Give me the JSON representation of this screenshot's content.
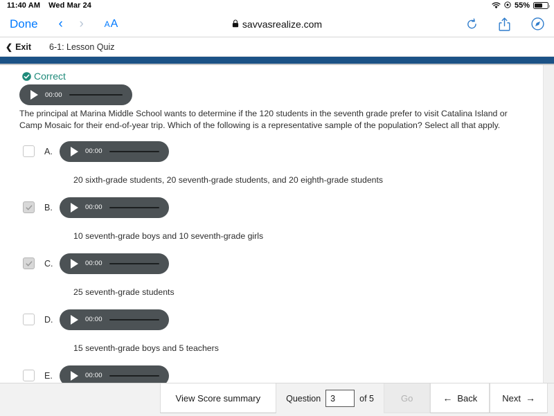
{
  "status_bar": {
    "time": "11:40 AM",
    "date": "Wed Mar 24",
    "wifi_icon": "wifi-icon",
    "location_icon": "location-icon",
    "battery_percent": "55%",
    "battery_icon": "battery-icon"
  },
  "safari": {
    "done_label": "Done",
    "back_glyph": "‹",
    "forward_glyph": "›",
    "text_size_small": "A",
    "text_size_big": "A",
    "lock_icon": "lock-icon",
    "url": "savvasrealize.com",
    "reload_icon": "reload-icon",
    "share_icon": "share-icon",
    "compass_icon": "compass-icon"
  },
  "lesson_header": {
    "exit_chevron": "❮",
    "exit_label": "Exit",
    "title": "6-1: Lesson Quiz"
  },
  "colors": {
    "rule_blue": "#1b5286",
    "correct_teal": "#1e8a7a",
    "audio_gray": "#4c5255",
    "ios_blue": "#007aff",
    "toolbar_blue": "#2e7ccc"
  },
  "feedback": {
    "check_icon": "check-circle-icon",
    "label": "Correct"
  },
  "question_audio": {
    "play_icon": "play-icon",
    "time": "00:00"
  },
  "question": {
    "text": "The principal at Marina Middle School wants to determine if the 120 students in the seventh grade prefer to visit Catalina Island or Camp Mosaic for their end-of-year trip. Which of the following is a representative sample of the population? Select all that apply."
  },
  "options": [
    {
      "letter": "A.",
      "checked": false,
      "audio_time": "00:00",
      "text": "20 sixth-grade students, 20 seventh-grade students, and 20 eighth-grade students"
    },
    {
      "letter": "B.",
      "checked": true,
      "audio_time": "00:00",
      "text": "10 seventh-grade boys and 10 seventh-grade girls"
    },
    {
      "letter": "C.",
      "checked": true,
      "audio_time": "00:00",
      "text": "25 seventh-grade students"
    },
    {
      "letter": "D.",
      "checked": false,
      "audio_time": "00:00",
      "text": "15 seventh-grade boys and 5 teachers"
    },
    {
      "letter": "E.",
      "checked": false,
      "audio_time": "00:00",
      "text": ""
    }
  ],
  "bottom_toolbar": {
    "score_summary_label": "View Score summary",
    "question_label": "Question",
    "question_value": "3",
    "of_label": "of 5",
    "go_label": "Go",
    "back_label": "Back",
    "back_arrow": "←",
    "next_label": "Next",
    "next_arrow": "→"
  }
}
